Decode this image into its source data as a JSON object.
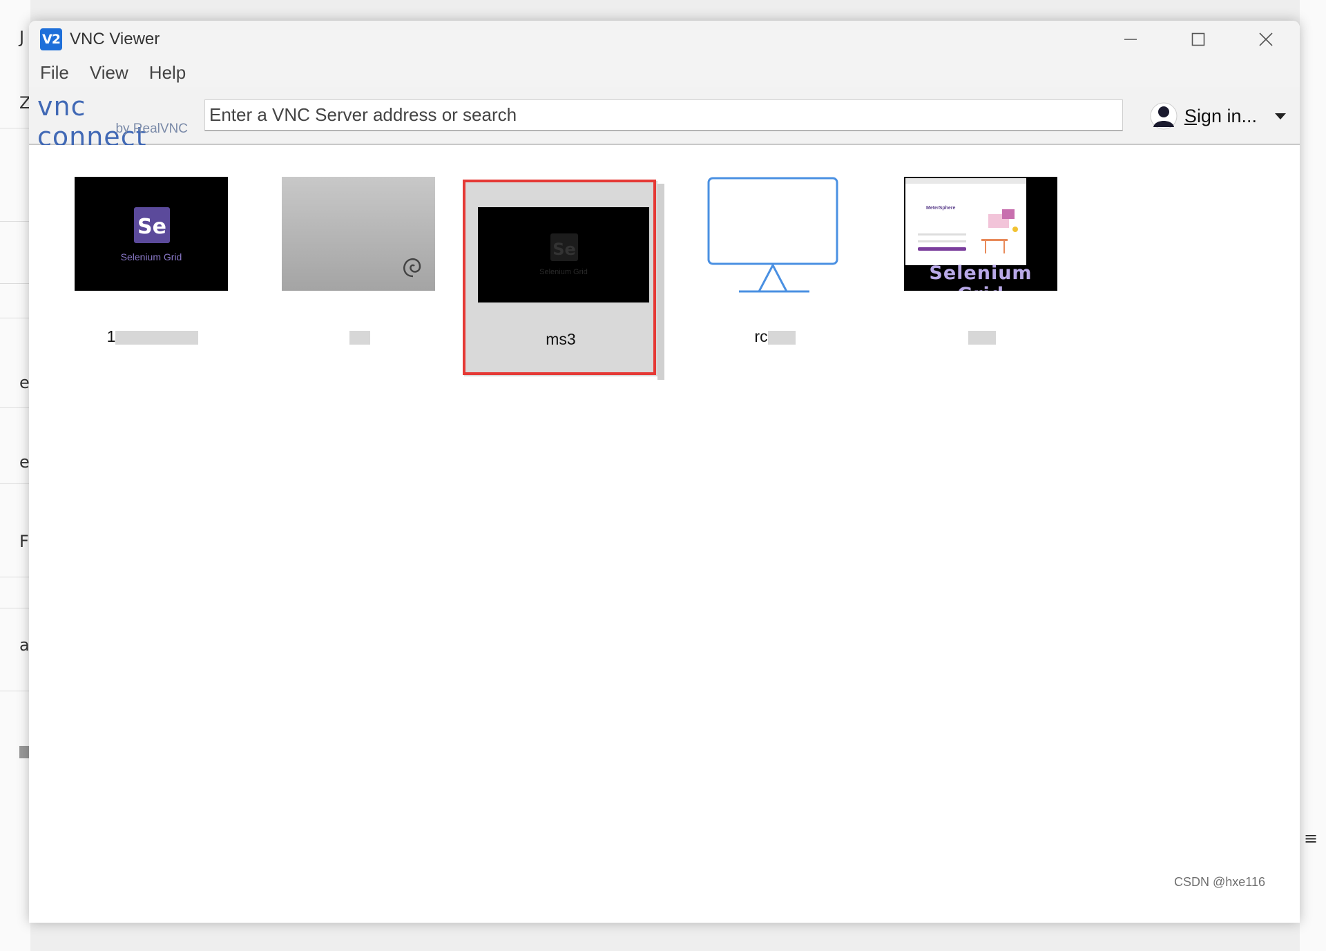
{
  "window": {
    "title": "VNC Viewer",
    "app_icon_text": "V2"
  },
  "menu": {
    "items": [
      "File",
      "View",
      "Help"
    ]
  },
  "logo": {
    "brand": "vnc connect",
    "byline": "by RealVNC"
  },
  "search": {
    "placeholder": "Enter a VNC Server address or search",
    "value": ""
  },
  "account": {
    "signin_label": "Sign in..."
  },
  "thumbnails": {
    "selenium_logo_text": "Se",
    "selenium_caption": "Selenium Grid",
    "banner_text": "Selenium Grid",
    "metersphere_text": "MeterSphere"
  },
  "connections": [
    {
      "label": "1",
      "label_visible": "1",
      "selected": false
    },
    {
      "label": "",
      "label_visible": "",
      "selected": false
    },
    {
      "label": "ms3",
      "label_visible": "ms3",
      "selected": true
    },
    {
      "label": "rc",
      "label_visible": "rc",
      "selected": false
    },
    {
      "label": "",
      "label_visible": "",
      "selected": false
    }
  ],
  "watermark": {
    "text": "CSDN @hxe116"
  },
  "colors": {
    "accent_blue": "#1e6fd9",
    "logo_blue": "#4169b5",
    "selection_red": "#e53935",
    "selenium_purple": "#5b4a9b",
    "monitor_blue": "#4a90e2"
  }
}
